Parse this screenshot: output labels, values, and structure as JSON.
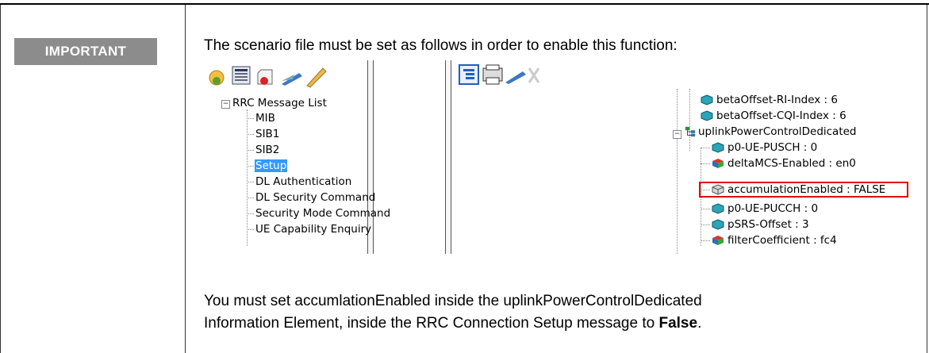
{
  "label": "IMPORTANT",
  "intro": "The scenario file must be set as follows in order to enable this function:",
  "left_tree": {
    "root": "RRC Message List",
    "items": [
      "MIB",
      "SIB1",
      "SIB2",
      "Setup",
      "DL Authentication",
      "DL Security Command",
      "Security Mode Command",
      "UE Capability Enquiry"
    ],
    "selected": "Setup"
  },
  "right_tree": [
    "betaOffset-RI-Index : 6",
    "betaOffset-CQI-Index : 6",
    "uplinkPowerControlDedicated",
    "p0-UE-PUSCH : 0",
    "deltaMCS-Enabled : en0",
    "accumulationEnabled : FALSE",
    "p0-UE-PUCCH : 0",
    "pSRS-Offset : 3",
    "filterCoefficient : fc4"
  ],
  "note": {
    "line1": "You must set accumlationEnabled inside the uplinkPowerControlDedicated",
    "line2_pre": "Information Element, inside the RRC Connection Setup message to ",
    "line2_bold": "False",
    "line2_post": "."
  },
  "colors": {
    "badge": "#8c8c8c",
    "highlight": "#e00000",
    "selection": "#3399ff"
  }
}
